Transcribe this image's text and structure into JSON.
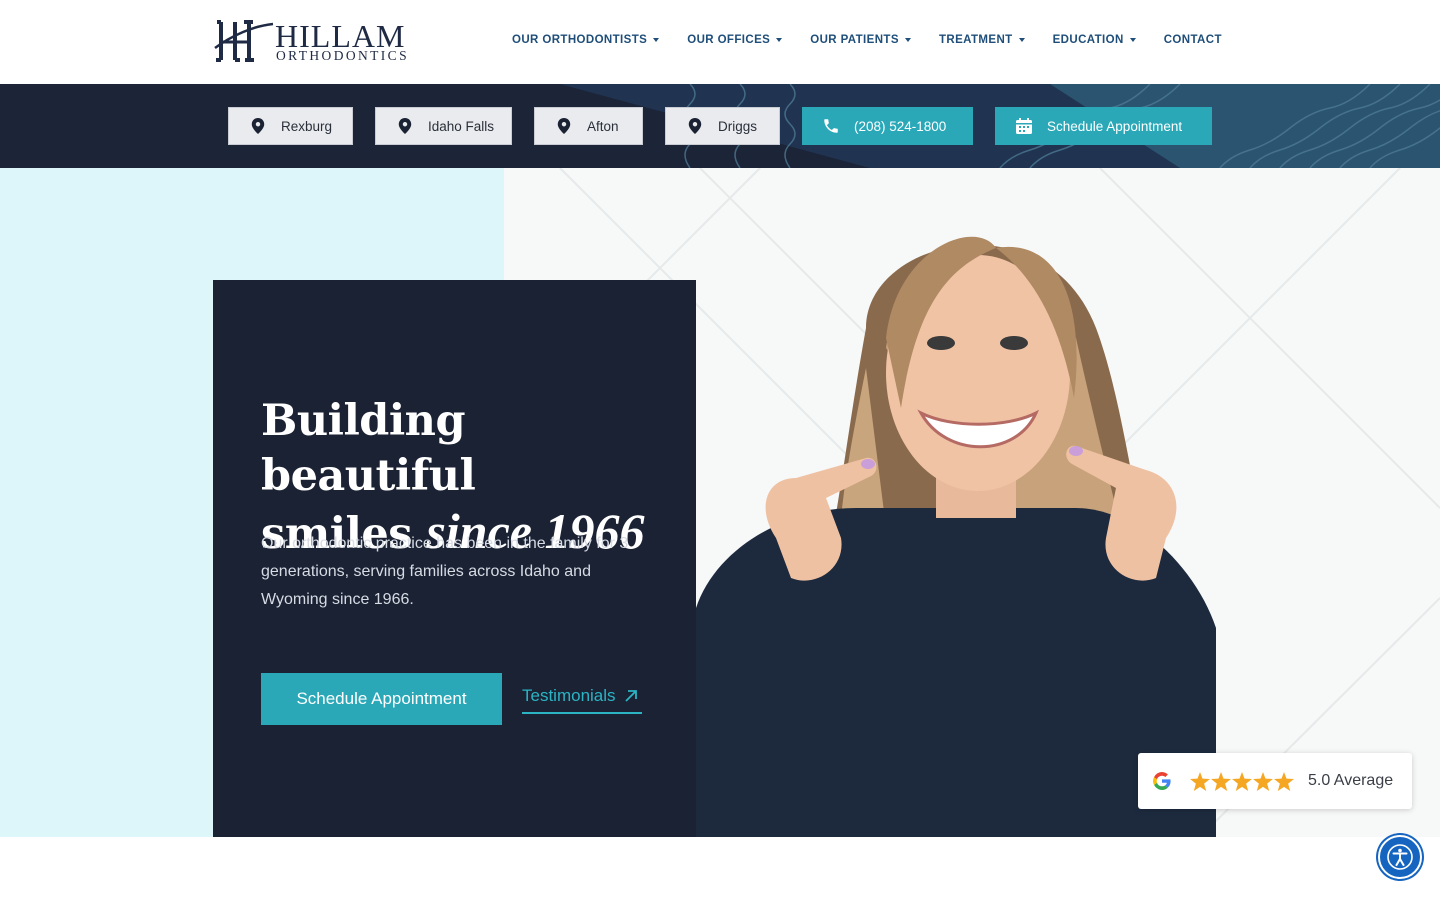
{
  "brand": {
    "name": "HILLAM",
    "sub": "ORTHODONTICS"
  },
  "nav": {
    "items": [
      {
        "label": "OUR ORTHODONTISTS",
        "dropdown": true
      },
      {
        "label": "OUR OFFICES",
        "dropdown": true
      },
      {
        "label": "OUR PATIENTS",
        "dropdown": true
      },
      {
        "label": "TREATMENT",
        "dropdown": true
      },
      {
        "label": "EDUCATION",
        "dropdown": true
      },
      {
        "label": "CONTACT",
        "dropdown": false
      }
    ]
  },
  "locations": [
    "Rexburg",
    "Idaho Falls",
    "Afton",
    "Driggs"
  ],
  "phone": "(208) 524-1800",
  "schedule_label": "Schedule Appointment",
  "hero": {
    "title_line1": "Building beautiful",
    "title_line2_plain": "smiles ",
    "title_line2_script": "since 1966",
    "description": "Our orthodontic practice has been in the family for 3 generations, serving families across Idaho and Wyoming since 1966.",
    "cta_label": "Schedule Appointment",
    "link_label": "Testimonials"
  },
  "review": {
    "stars": 5,
    "rating_text": "5.0 Average"
  },
  "colors": {
    "navy": "#1b2233",
    "teal": "#2aa8b8",
    "light_teal": "#ddf6f9",
    "nav_blue": "#1e4e79",
    "star": "#f5a623"
  },
  "icons": [
    "location-pin-icon",
    "phone-icon",
    "calendar-icon",
    "arrow-up-right-icon",
    "google-icon",
    "star-icon",
    "accessibility-icon"
  ]
}
